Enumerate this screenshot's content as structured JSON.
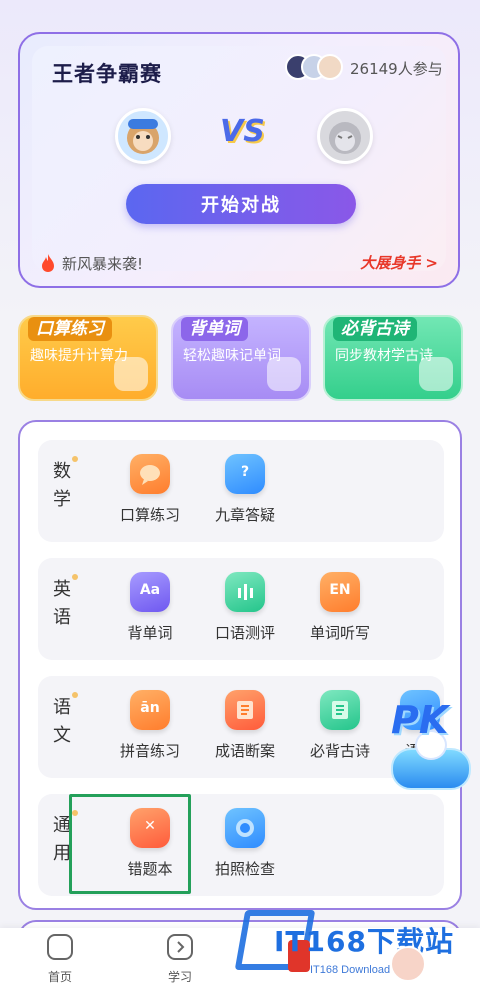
{
  "battle": {
    "title": "王者争霸赛",
    "participants": "26149人参与",
    "vs": "VS",
    "start_button": "开始对战",
    "news": "新风暴来袭!",
    "action_link": "大展身手 >"
  },
  "features": [
    {
      "title": "口算练习",
      "subtitle": "趣味提升计算力"
    },
    {
      "title": "背单词",
      "subtitle": "轻松趣味记单词"
    },
    {
      "title": "必背古诗",
      "subtitle": "同步教材学古诗"
    }
  ],
  "subjects": {
    "math": {
      "label": "数学",
      "items": [
        {
          "label": "口算练习",
          "icon": "speech-bubble-icon",
          "color": "#ff8a33"
        },
        {
          "label": "九章答疑",
          "icon": "question-icon",
          "color": "#2f8cff"
        }
      ]
    },
    "english": {
      "label": "英语",
      "items": [
        {
          "label": "背单词",
          "icon": "book-aa-icon",
          "color": "#6f58f0"
        },
        {
          "label": "口语测评",
          "icon": "voice-wave-icon",
          "color": "#24c58b"
        },
        {
          "label": "单词听写",
          "icon": "en-icon",
          "color": "#ff7d2d"
        }
      ]
    },
    "chinese": {
      "label": "语文",
      "items": [
        {
          "label": "拼音练习",
          "icon": "pinyin-icon",
          "color": "#ff8a33"
        },
        {
          "label": "成语断案",
          "icon": "scroll-icon",
          "color": "#ff7d2d"
        },
        {
          "label": "必背古诗",
          "icon": "poem-icon",
          "color": "#24c58b"
        },
        {
          "label": "语文",
          "icon": "more-icon",
          "color": "#2f8cff"
        }
      ]
    },
    "general": {
      "label": "通用",
      "items": [
        {
          "label": "错题本",
          "icon": "wrong-answer-icon",
          "color": "#ff5b3b"
        },
        {
          "label": "拍照检查",
          "icon": "camera-icon",
          "color": "#2f8cff"
        }
      ]
    }
  },
  "pk_badge": "PK",
  "tabs": [
    {
      "label": "首页",
      "icon": "home-icon"
    },
    {
      "label": "学习",
      "icon": "play-icon"
    }
  ],
  "watermark": {
    "title": "IT168下载站",
    "subtitle": "IT168 Download"
  }
}
